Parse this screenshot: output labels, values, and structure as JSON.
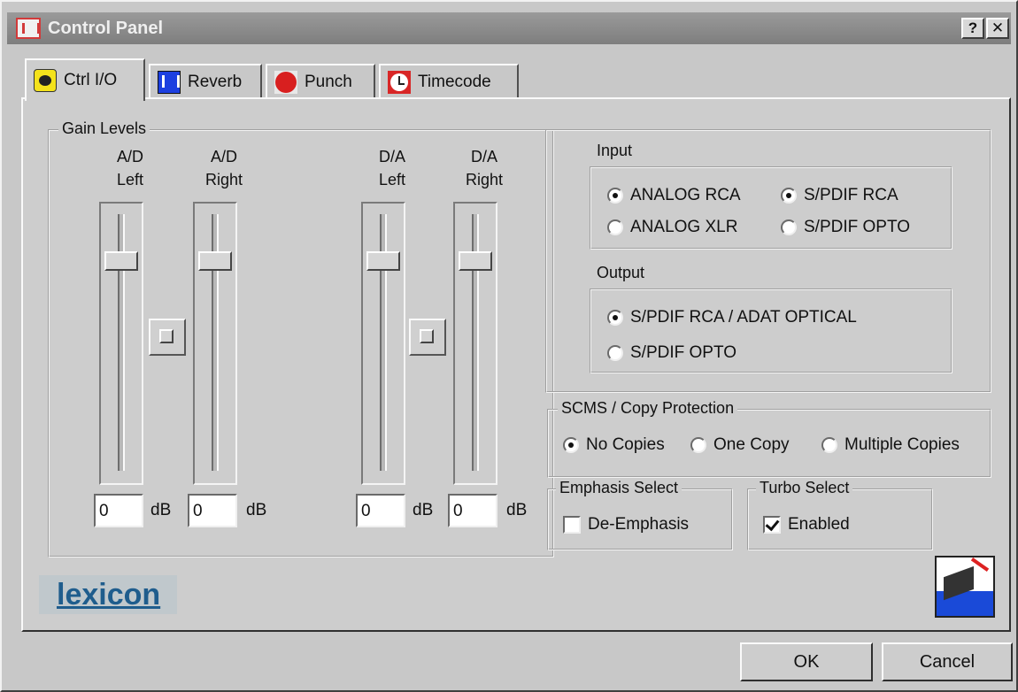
{
  "window": {
    "title": "Control Panel",
    "help_label": "?",
    "close_label": "✕"
  },
  "tabs": [
    {
      "label": "Ctrl I/O",
      "icon": "face-icon",
      "active": true
    },
    {
      "label": "Reverb",
      "icon": "reverb-icon",
      "active": false
    },
    {
      "label": "Punch",
      "icon": "record-icon",
      "active": false
    },
    {
      "label": "Timecode",
      "icon": "clock-icon",
      "active": false
    }
  ],
  "gain": {
    "legend": "Gain Levels",
    "channels": [
      {
        "line1": "A/D",
        "line2": "Left",
        "value": "0",
        "unit": "dB"
      },
      {
        "line1": "A/D",
        "line2": "Right",
        "value": "0",
        "unit": "dB"
      },
      {
        "line1": "D/A",
        "line2": "Left",
        "value": "0",
        "unit": "dB"
      },
      {
        "line1": "D/A",
        "line2": "Right",
        "value": "0",
        "unit": "dB"
      }
    ]
  },
  "input": {
    "legend": "Input",
    "options": [
      {
        "label": "ANALOG RCA",
        "selected": true
      },
      {
        "label": "S/PDIF RCA",
        "selected": true
      },
      {
        "label": "ANALOG XLR",
        "selected": false
      },
      {
        "label": "S/PDIF OPTO",
        "selected": false
      }
    ]
  },
  "output": {
    "legend": "Output",
    "options": [
      {
        "label": "S/PDIF RCA / ADAT OPTICAL",
        "selected": true
      },
      {
        "label": "S/PDIF OPTO",
        "selected": false
      }
    ]
  },
  "scms": {
    "legend": "SCMS / Copy Protection",
    "options": [
      {
        "label": "No Copies",
        "selected": true
      },
      {
        "label": "One Copy",
        "selected": false
      },
      {
        "label": "Multiple Copies",
        "selected": false
      }
    ]
  },
  "emphasis": {
    "legend": "Emphasis Select",
    "label": "De-Emphasis",
    "checked": false
  },
  "turbo": {
    "legend": "Turbo Select",
    "label": "Enabled",
    "checked": true
  },
  "brand": {
    "name": "lexicon"
  },
  "buttons": {
    "ok": "OK",
    "cancel": "Cancel"
  }
}
